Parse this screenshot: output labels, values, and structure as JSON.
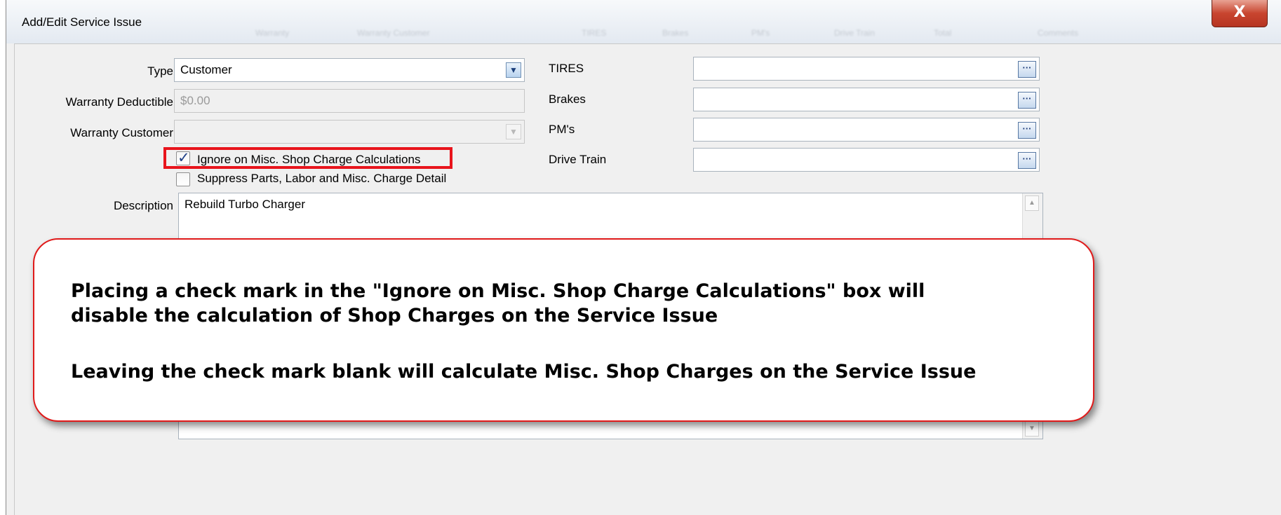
{
  "window": {
    "title": "Add/Edit Service Issue",
    "close_label": "X",
    "background_tabs": [
      "Warranty",
      "Warranty Customer",
      "TIRES",
      "Brakes",
      "PM's",
      "Drive Train",
      "Total",
      "Comments"
    ]
  },
  "form": {
    "type": {
      "label": "Type",
      "value": "Customer"
    },
    "warranty_deductible": {
      "label": "Warranty Deductible",
      "value": "$0.00"
    },
    "warranty_customer": {
      "label": "Warranty Customer",
      "value": ""
    },
    "ignore_checkbox": {
      "label": "Ignore on Misc. Shop Charge Calculations",
      "checked": true
    },
    "suppress_checkbox": {
      "label": "Suppress Parts, Labor and Misc. Charge Detail",
      "checked": false
    },
    "description": {
      "label": "Description",
      "value": "Rebuild Turbo Charger"
    }
  },
  "right_fields": [
    {
      "label": "TIRES",
      "value": ""
    },
    {
      "label": "Brakes",
      "value": ""
    },
    {
      "label": "PM's",
      "value": ""
    },
    {
      "label": "Drive Train",
      "value": ""
    }
  ],
  "icons": {
    "dropdown": "chevron-down-icon",
    "lookup": "ellipsis-icon",
    "check": "checkmark-icon"
  },
  "callout": {
    "line1": "Placing a check mark in the  \"Ignore on Misc. Shop Charge Calculations\" box will",
    "line2": "disable the calculation of Shop Charges on the Service Issue",
    "line3": "Leaving the check mark blank will calculate Misc. Shop Charges on the Service Issue",
    "border_color": "#e01a1a"
  },
  "colors": {
    "highlight": "#e8141c",
    "close_button": "#c8452f"
  }
}
